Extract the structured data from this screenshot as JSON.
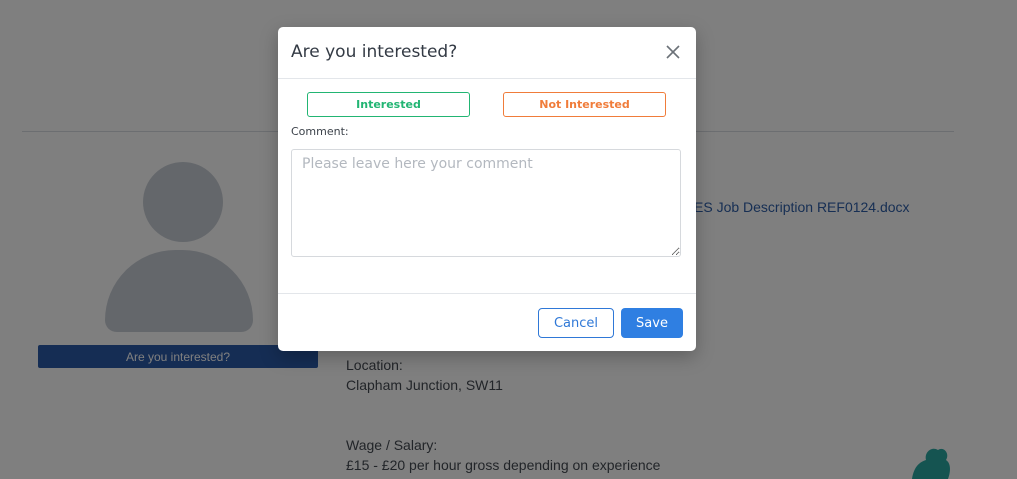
{
  "background": {
    "are_you_interested_button": "Are you interested?",
    "document_link": "ES Job Description REF0124.docx",
    "location_label": "Location:",
    "location_value": "Clapham Junction, SW11",
    "wage_label": "Wage / Salary:",
    "wage_value": "£15 - £20 per hour gross depending on experience"
  },
  "modal": {
    "title": "Are you interested?",
    "interested_label": "Interested",
    "not_interested_label": "Not Interested",
    "comment_label": "Comment:",
    "comment_placeholder": "Please leave here your comment",
    "comment_value": "",
    "cancel_label": "Cancel",
    "save_label": "Save"
  },
  "colors": {
    "primary_blue": "#2f7fe2",
    "interested_green": "#22b573",
    "not_interested_orange": "#f07c3a",
    "background_button_blue": "#2b5aa8"
  },
  "icons": {
    "close": "close-icon",
    "avatar": "avatar-icon",
    "plant": "plant-icon"
  }
}
